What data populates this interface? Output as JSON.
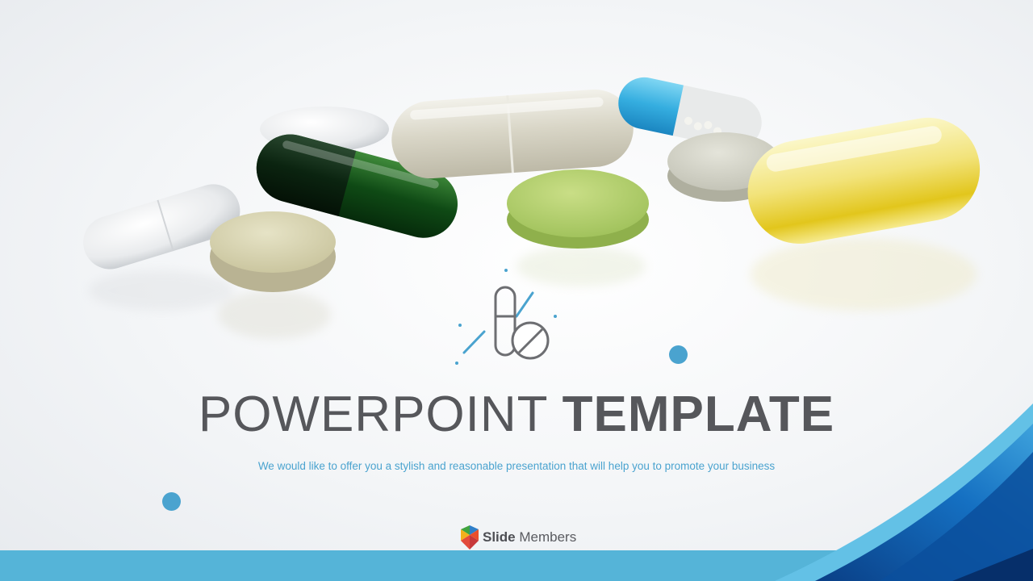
{
  "slide": {
    "title_light": "POWERPOINT",
    "title_bold": "TEMPLATE",
    "subtitle": "We would like to offer you a stylish and reasonable presentation that will help you to promote your business",
    "brand_bold": "Slide",
    "brand_rest": " Members"
  },
  "icons": {
    "center": "pill-capsule-tablet-icon",
    "brand": "slide-members-logo"
  },
  "colors": {
    "accent": "#4aa3cf",
    "title": "#56575b",
    "band": "#55b4d8",
    "corner_dark": "#0b4f9c"
  }
}
